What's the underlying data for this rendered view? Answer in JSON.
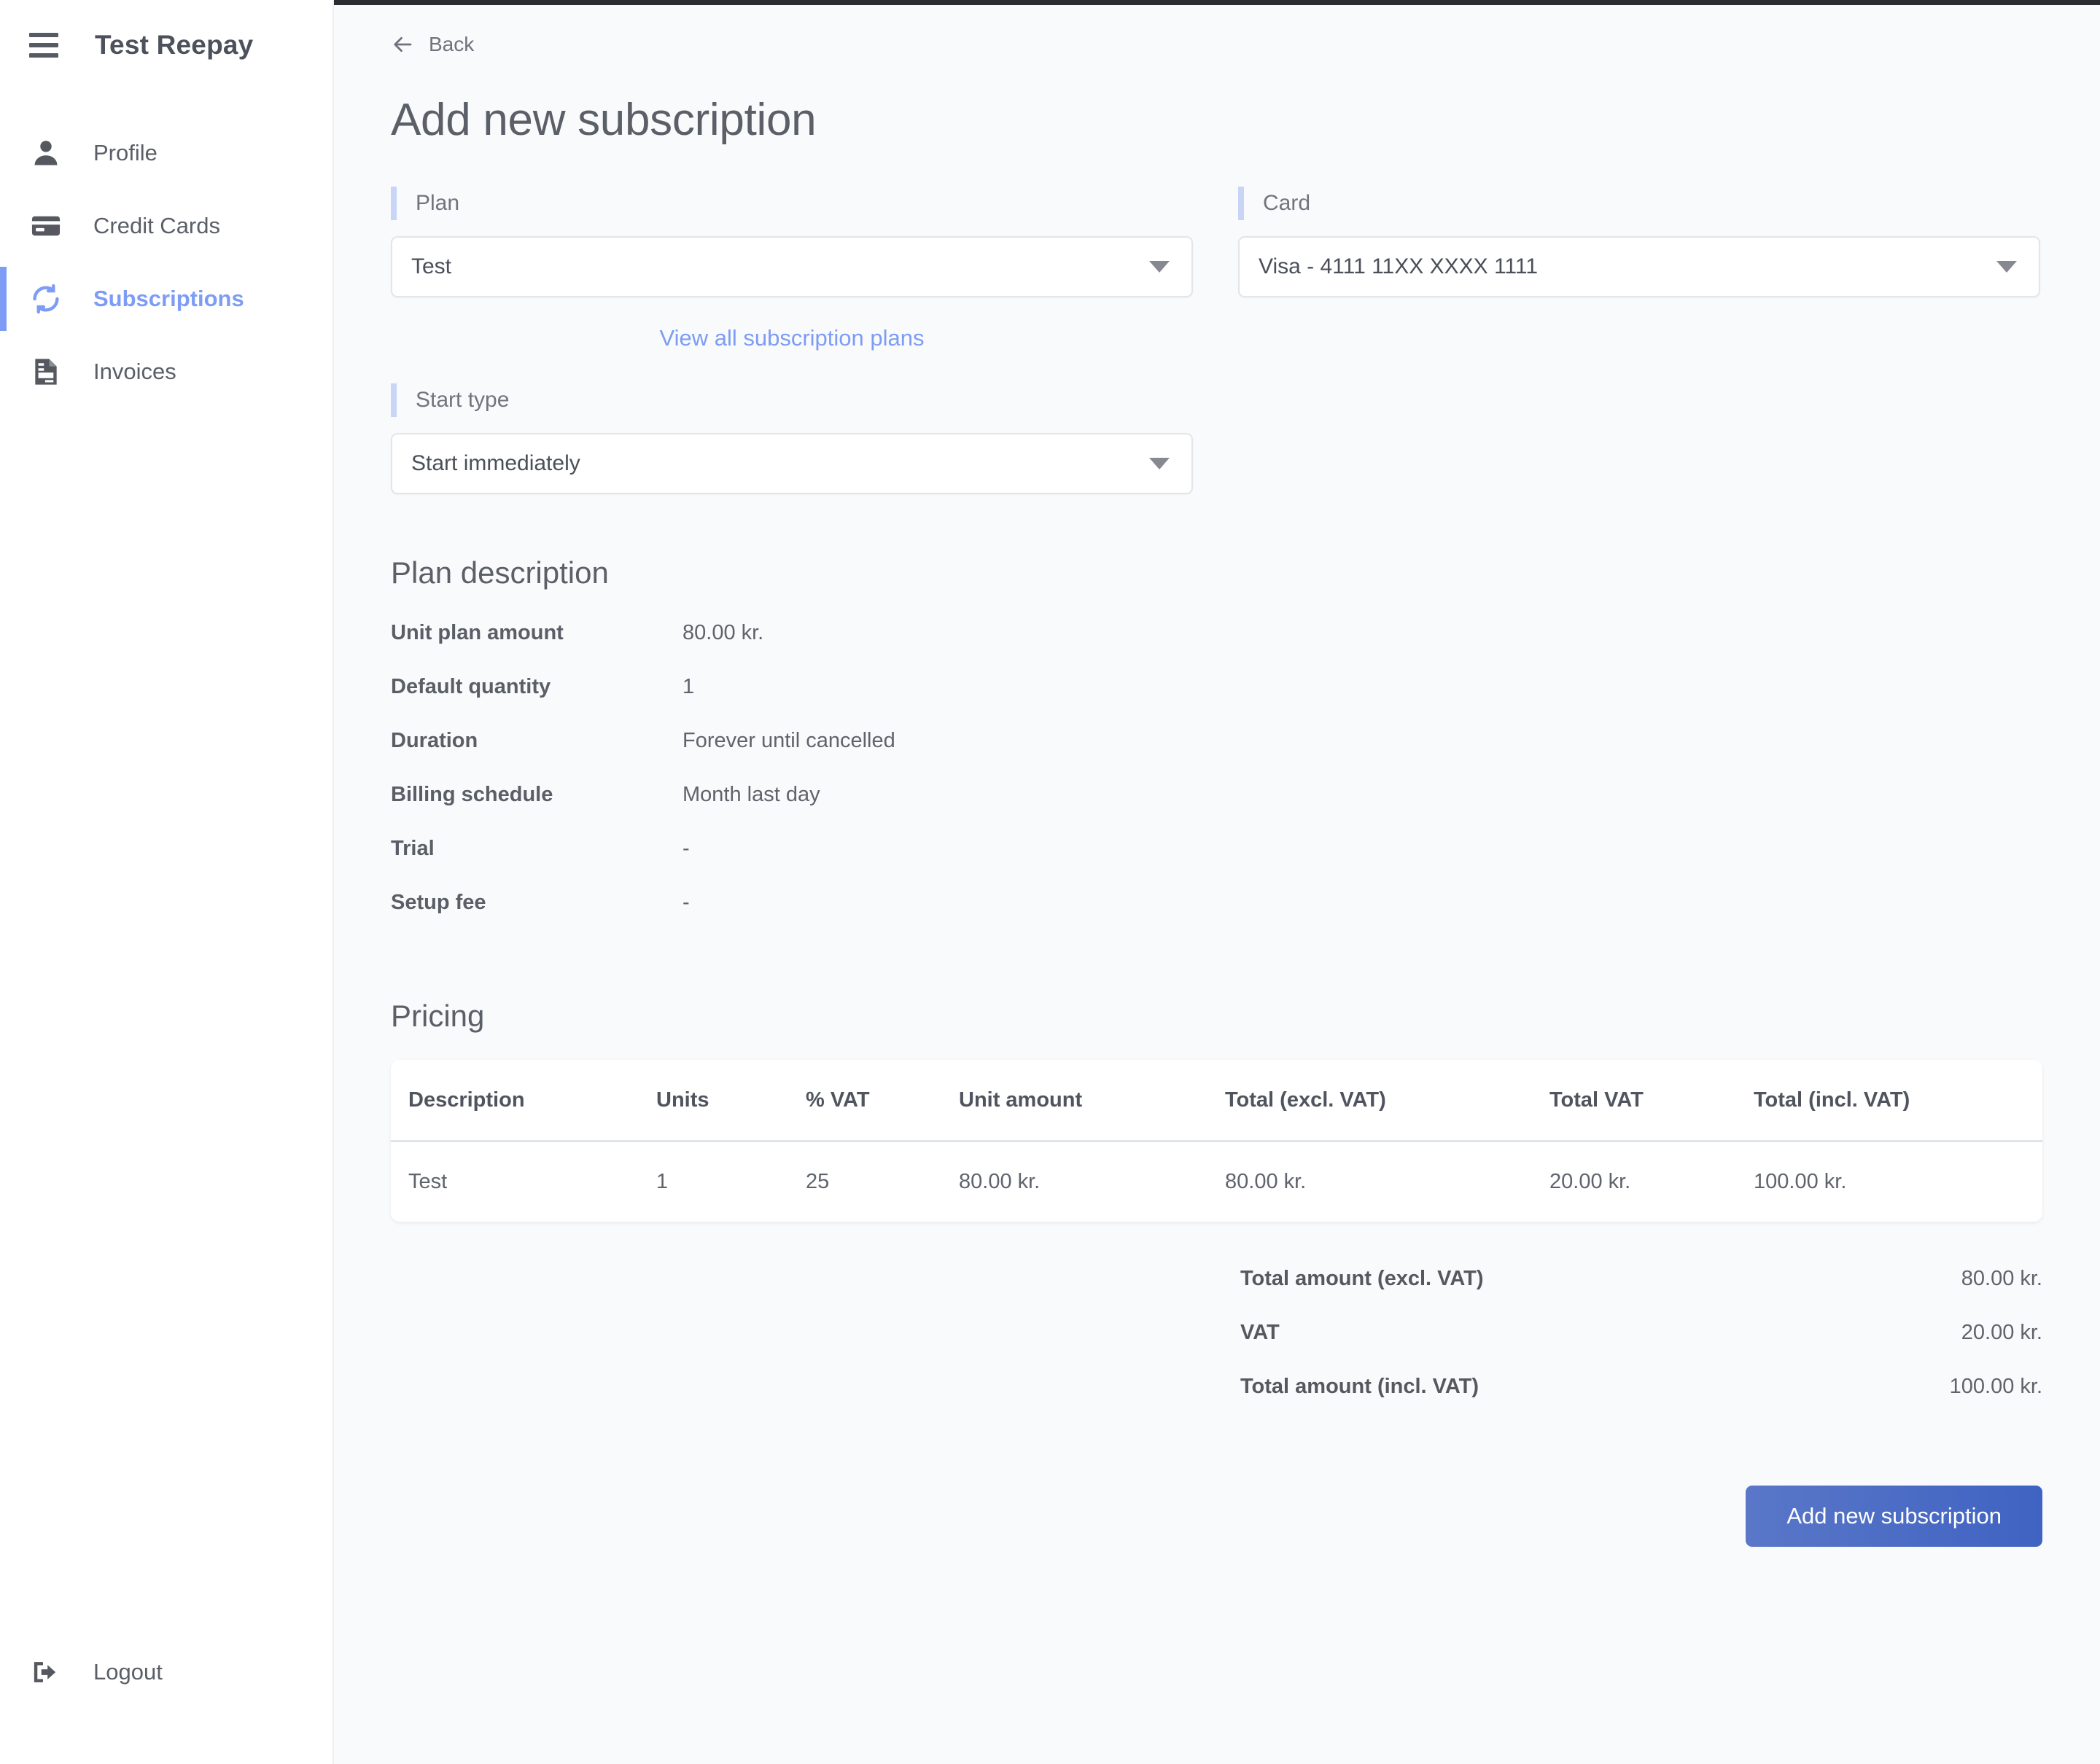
{
  "sidebar": {
    "brand": "Test Reepay",
    "menu_icon": "hamburger-icon",
    "items": [
      {
        "label": "Profile",
        "icon": "user-icon",
        "active": false
      },
      {
        "label": "Credit Cards",
        "icon": "credit-card-icon",
        "active": false
      },
      {
        "label": "Subscriptions",
        "icon": "refresh-sync-icon",
        "active": true
      },
      {
        "label": "Invoices",
        "icon": "document-icon",
        "active": false
      }
    ],
    "logout": {
      "label": "Logout",
      "icon": "logout-icon"
    }
  },
  "main": {
    "back_label": "Back",
    "back_icon": "arrow-left-icon",
    "page_title": "Add new subscription",
    "fields": {
      "plan": {
        "label": "Plan",
        "value": "Test",
        "caret_icon": "chevron-down-icon"
      },
      "card": {
        "label": "Card",
        "value": "Visa - 4111 11XX XXXX 1111",
        "caret_icon": "chevron-down-icon"
      },
      "start_type": {
        "label": "Start type",
        "value": "Start immediately",
        "caret_icon": "chevron-down-icon"
      }
    },
    "view_all_plans_link": "View all subscription plans",
    "plan_description": {
      "title": "Plan description",
      "rows": [
        {
          "key": "Unit plan amount",
          "value": "80.00 kr."
        },
        {
          "key": "Default quantity",
          "value": "1"
        },
        {
          "key": "Duration",
          "value": "Forever until cancelled"
        },
        {
          "key": "Billing schedule",
          "value": "Month last day"
        },
        {
          "key": "Trial",
          "value": "-"
        },
        {
          "key": "Setup fee",
          "value": "-"
        }
      ]
    },
    "pricing": {
      "title": "Pricing",
      "columns": [
        "Description",
        "Units",
        "% VAT",
        "Unit amount",
        "Total (excl. VAT)",
        "Total VAT",
        "Total (incl. VAT)"
      ],
      "rows": [
        {
          "description": "Test",
          "units": "1",
          "vat_percent": "25",
          "unit_amount": "80.00 kr.",
          "total_excl_vat": "80.00 kr.",
          "total_vat": "20.00 kr.",
          "total_incl_vat": "100.00 kr."
        }
      ],
      "totals": [
        {
          "label": "Total amount (excl. VAT)",
          "value": "80.00 kr."
        },
        {
          "label": "VAT",
          "value": "20.00 kr."
        },
        {
          "label": "Total amount (incl. VAT)",
          "value": "100.00 kr."
        }
      ]
    },
    "submit_label": "Add new subscription"
  },
  "colors": {
    "accent_blue": "#7d9cf5",
    "label_accent": "#c8d5f7",
    "button_gradient_from": "#5a77c8",
    "button_gradient_to": "#3f63c2",
    "text_primary": "#5b5f68",
    "page_background": "#f9fafb"
  }
}
